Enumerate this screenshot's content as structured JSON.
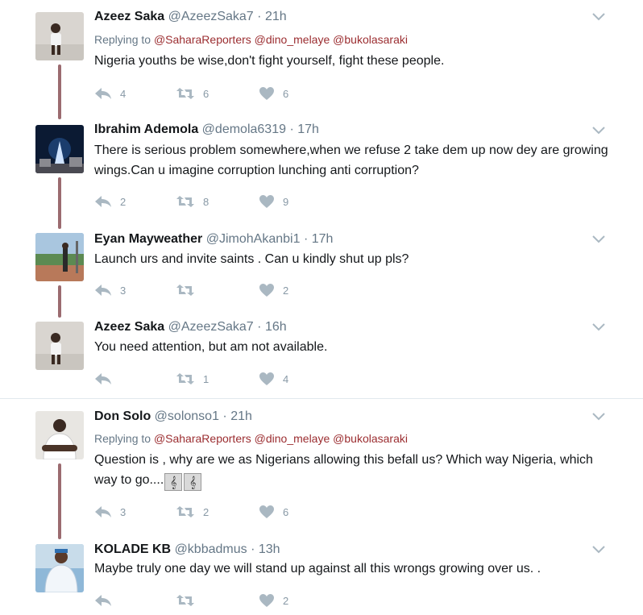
{
  "tweets": [
    {
      "name": "Azeez Saka",
      "handle": "@AzeezSaka7",
      "sep": "·",
      "time": "21h",
      "reply_prefix": "Replying to",
      "reply_mentions": [
        "@SaharaReporters",
        "@dino_melaye",
        "@bukolasaraki"
      ],
      "text": "Nigeria youths be wise,don't fight yourself, fight these people.",
      "replies": "4",
      "retweets": "6",
      "likes": "6"
    },
    {
      "name": "Ibrahim Ademola",
      "handle": "@demola6319",
      "sep": "·",
      "time": "17h",
      "text": "There is serious problem somewhere,when we refuse 2 take dem up now dey are growing wings.Can u imagine corruption lunching anti corruption?",
      "replies": "2",
      "retweets": "8",
      "likes": "9"
    },
    {
      "name": "Eyan Mayweather",
      "handle": "@JimohAkanbi1",
      "sep": "·",
      "time": "17h",
      "text": "Launch urs and invite saints . Can u kindly shut up pls?",
      "replies": "3",
      "retweets": "",
      "likes": "2"
    },
    {
      "name": "Azeez Saka",
      "handle": "@AzeezSaka7",
      "sep": "·",
      "time": "16h",
      "text": "You need attention, but am not available.",
      "replies": "",
      "retweets": "1",
      "likes": "4"
    },
    {
      "name": "Don Solo",
      "handle": "@solonso1",
      "sep": "·",
      "time": "21h",
      "reply_prefix": "Replying to",
      "reply_mentions": [
        "@SaharaReporters",
        "@dino_melaye",
        "@bukolasaraki"
      ],
      "text": "Question is , why are we as Nigerians allowing this  befall us? Which way Nigeria, which way to go....",
      "emoji": [
        "𝄞",
        "𝄞"
      ],
      "replies": "3",
      "retweets": "2",
      "likes": "6"
    },
    {
      "name": "KOLADE KB",
      "handle": "@kbbadmus",
      "sep": "·",
      "time": "13h",
      "text": "Maybe truly one day we will stand up against all this wrongs growing over us. .",
      "replies": "",
      "retweets": "",
      "likes": "2"
    }
  ],
  "icons": {
    "reply": "reply-icon",
    "retweet": "retweet-icon",
    "like": "heart-icon",
    "more": "chevron-down-icon"
  },
  "colors": {
    "mention": "#9b2d30",
    "thread_line": "#9b6b70",
    "muted": "#657786",
    "icon": "#aab8c2"
  }
}
